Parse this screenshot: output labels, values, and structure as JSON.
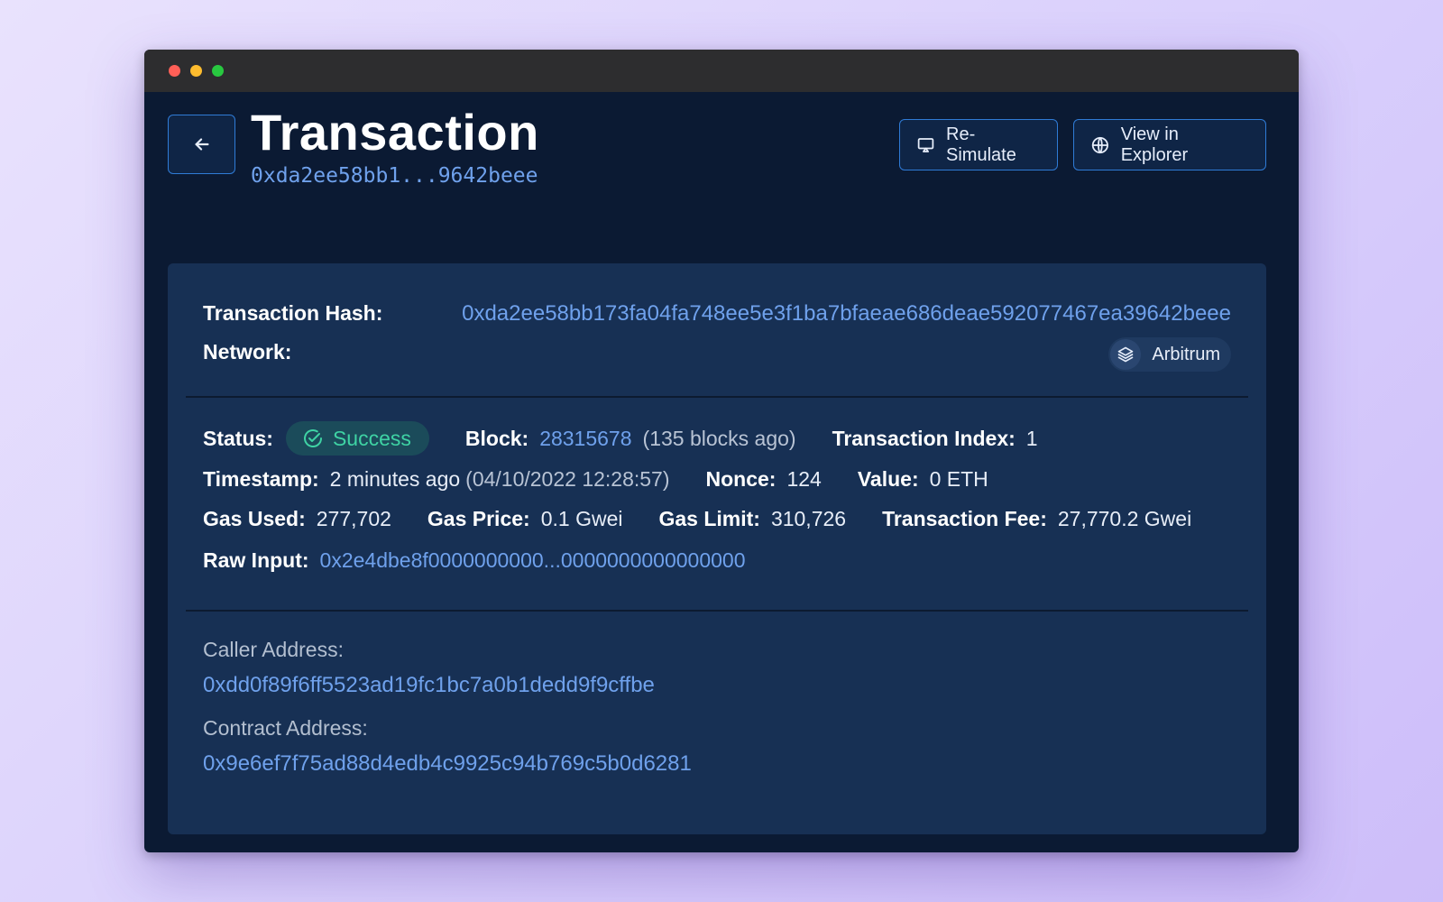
{
  "window": {
    "controls": [
      "close",
      "minimize",
      "maximize"
    ]
  },
  "header": {
    "back_icon": "arrow-left-icon",
    "title": "Transaction",
    "tx_short": "0xda2ee58bb1...9642beee",
    "resimulate_label": "Re-Simulate",
    "resimulate_icon": "monitor-play-icon",
    "explorer_label": "View in Explorer",
    "explorer_icon": "globe-icon"
  },
  "summary": {
    "hash_label": "Transaction Hash:",
    "hash_value": "0xda2ee58bb173fa04fa748ee5e3f1ba7bfaeae686deae592077467ea39642beee",
    "network_label": "Network:",
    "network_value": "Arbitrum",
    "network_icon": "layers-icon"
  },
  "details": {
    "status_label": "Status:",
    "status_value": "Success",
    "status_color": "#3fd3a4",
    "block_label": "Block:",
    "block_value": "28315678",
    "block_ago": "(135 blocks ago)",
    "tx_index_label": "Transaction Index:",
    "tx_index_value": "1",
    "timestamp_label": "Timestamp:",
    "timestamp_relative": "2 minutes ago",
    "timestamp_absolute": "(04/10/2022 12:28:57)",
    "nonce_label": "Nonce:",
    "nonce_value": "124",
    "value_label": "Value:",
    "value_value": "0 ETH",
    "gas_used_label": "Gas Used:",
    "gas_used_value": "277,702",
    "gas_price_label": "Gas Price:",
    "gas_price_value": "0.1 Gwei",
    "gas_limit_label": "Gas Limit:",
    "gas_limit_value": "310,726",
    "tx_fee_label": "Transaction Fee:",
    "tx_fee_value": "27,770.2 Gwei",
    "raw_input_label": "Raw Input:",
    "raw_input_value": "0x2e4dbe8f0000000000...0000000000000000"
  },
  "addresses": {
    "caller_label": "Caller Address:",
    "caller_value": "0xdd0f89f6ff5523ad19fc1bc7a0b1dedd9f9cffbe",
    "contract_label": "Contract Address:",
    "contract_value": "0x9e6ef7f75ad88d4edb4c9925c94b769c5b0d6281"
  },
  "colors": {
    "accent": "#6fa1ec",
    "background": "#0b1a33",
    "card": "#173054",
    "button_border": "#2f7bd6"
  }
}
